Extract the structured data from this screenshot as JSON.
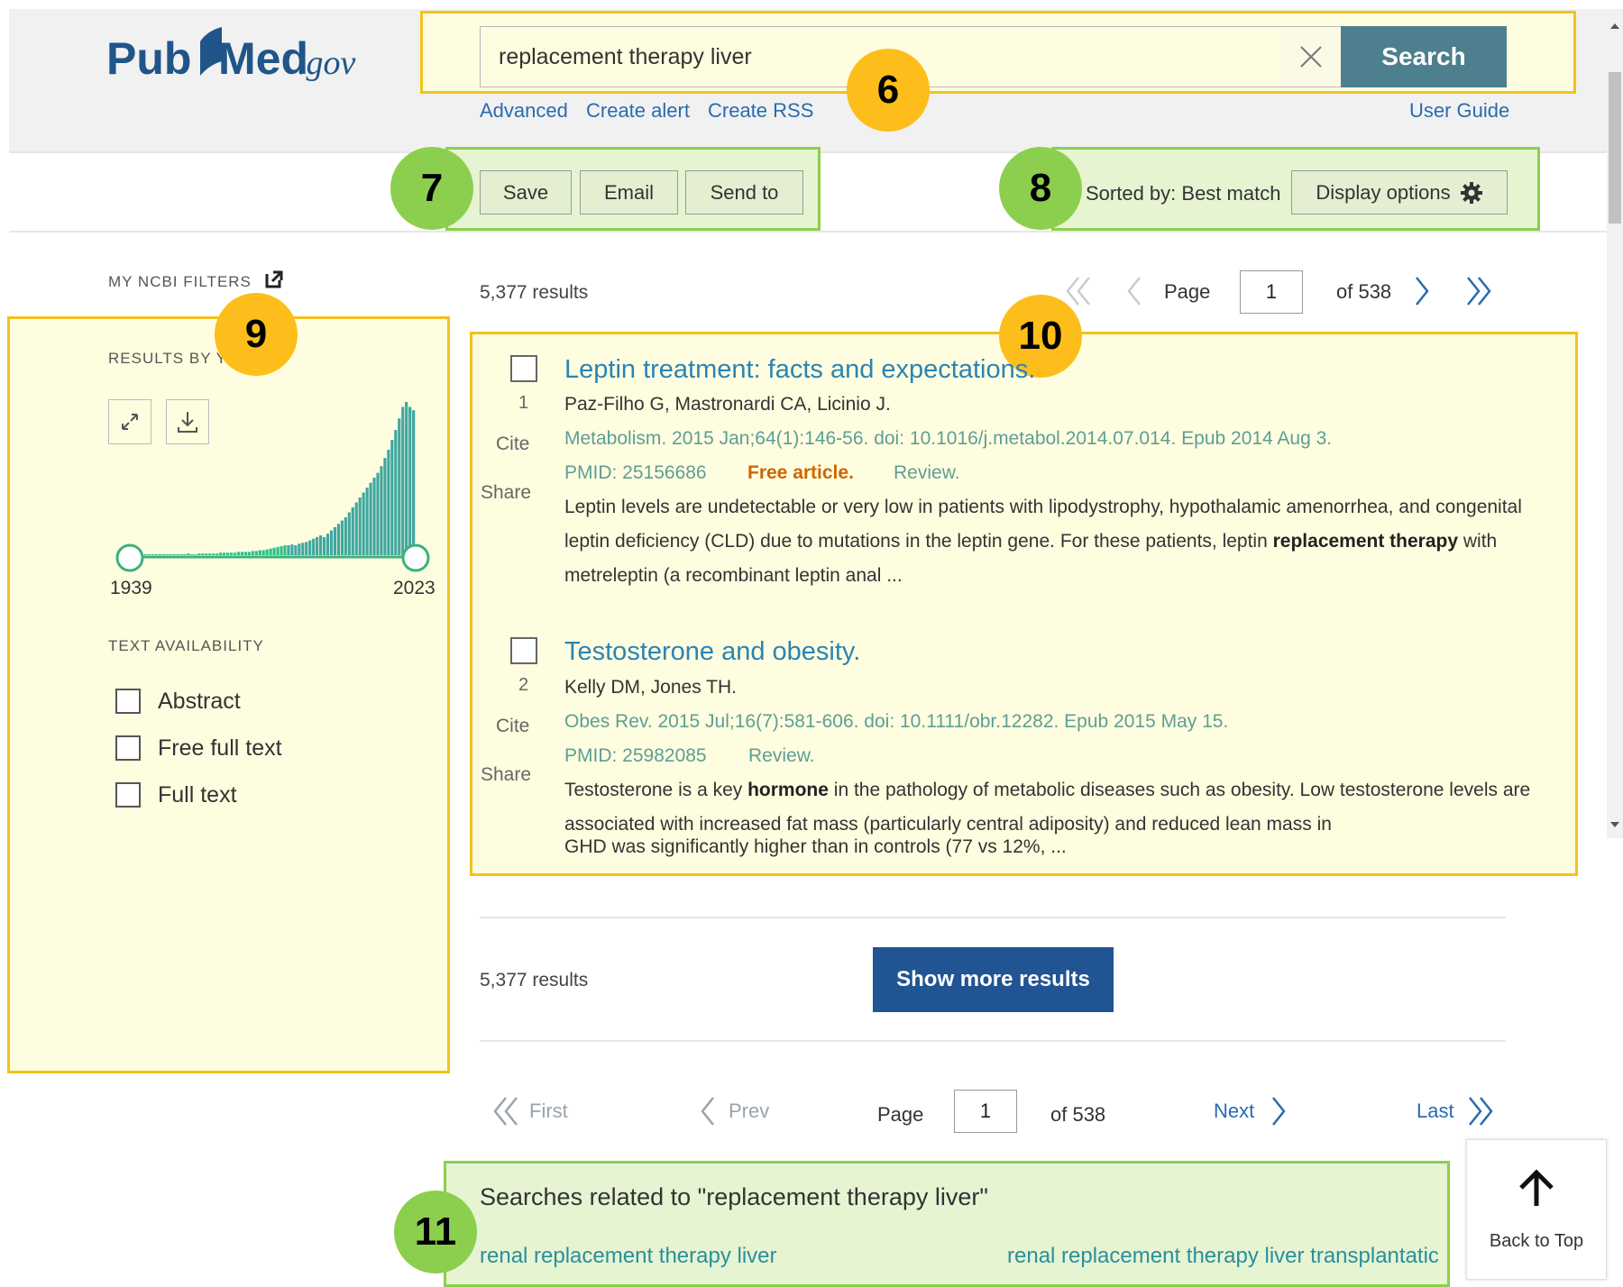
{
  "header": {
    "logo_pub": "Pub",
    "logo_med": "Med",
    "logo_gov": ".gov",
    "search_value": "replacement therapy liver",
    "search_button": "Search",
    "links": [
      "Advanced",
      "Create alert",
      "Create RSS"
    ],
    "user_guide": "User Guide"
  },
  "badges": {
    "b6": "6",
    "b7": "7",
    "b8": "8",
    "b9": "9",
    "b10": "10",
    "b11": "11"
  },
  "toolbar": {
    "save": "Save",
    "email": "Email",
    "send_to": "Send to",
    "sorted_by": "Sorted by: Best match",
    "display_options": "Display options"
  },
  "sidebar": {
    "my_ncbi_filters": "MY NCBI FILTERS",
    "results_by_year": "RESULTS BY YEAR",
    "year_start": "1939",
    "year_end": "2023",
    "text_availability": "TEXT AVAILABILITY",
    "filters": [
      "Abstract",
      "Free full text",
      "Full text"
    ],
    "histogram": [
      1,
      1,
      1,
      1,
      1,
      1,
      1,
      1,
      1,
      1,
      1,
      1,
      1,
      1,
      1,
      1,
      2,
      1,
      1,
      2,
      2,
      2,
      2,
      2,
      2,
      3,
      3,
      3,
      3,
      3,
      4,
      4,
      4,
      4,
      5,
      5,
      6,
      6,
      7,
      8,
      9,
      10,
      11,
      12,
      12,
      13,
      12,
      14,
      15,
      16,
      18,
      20,
      22,
      24,
      22,
      26,
      30,
      34,
      38,
      42,
      46,
      52,
      58,
      64,
      70,
      76,
      82,
      88,
      94,
      100,
      108,
      118,
      128,
      140,
      152,
      166,
      180,
      186,
      180,
      176
    ],
    "histogram_max": 186
  },
  "results": {
    "count_label": "5,377 results",
    "page_label": "Page",
    "page_value": "1",
    "of_label": "of 538",
    "items": [
      {
        "num": "1",
        "title": "Leptin treatment: facts and expectations.",
        "authors": "Paz-Filho G, Mastronardi CA, Licinio J.",
        "journal": "Metabolism. 2015 Jan;64(1):146-56. doi: 10.1016/j.metabol.2014.07.014. Epub 2014 Aug 3.",
        "pmid": "PMID: 25156686",
        "free": "Free article.",
        "review": "Review.",
        "snippet_a": "Leptin levels are undetectable or very low in patients with lipodystrophy, hypothalamic amenorrhea, and congenital leptin deficiency (CLD) due to mutations in the leptin gene. For these patients, leptin ",
        "snippet_b": "replacement therapy",
        "snippet_c": " with metreleptin (a recombinant leptin anal ..."
      },
      {
        "num": "2",
        "title": "Testosterone and obesity.",
        "authors": "Kelly DM, Jones TH.",
        "journal": "Obes Rev. 2015 Jul;16(7):581-606. doi: 10.1111/obr.12282. Epub 2015 May 15.",
        "pmid": "PMID: 25982085",
        "review": "Review.",
        "snippet_a": "Testosterone is a key ",
        "snippet_b": "hormone",
        "snippet_c": " in the pathology of metabolic diseases such as obesity. Low testosterone levels are associated with increased fat mass (particularly central adiposity) and reduced lean mass in",
        "snippet_d": "GHD was significantly higher than in controls (77 vs 12%, ..."
      }
    ],
    "cite": "Cite",
    "share": "Share"
  },
  "bottom": {
    "count_label": "5,377 results",
    "show_more": "Show more results",
    "first": "First",
    "prev": "Prev",
    "page_label": "Page",
    "page_value": "1",
    "of_label": "of 538",
    "next": "Next",
    "last": "Last"
  },
  "related": {
    "heading": "Searches related to \"replacement therapy liver\"",
    "links": [
      "renal replacement therapy liver",
      "renal replacement therapy liver transplantatic"
    ]
  },
  "back_to_top": "Back to Top",
  "colors": {
    "accent": "#2a84b4",
    "search_button": "#4d7f8e",
    "show_more": "#205493",
    "highlight_yellow": "#f3c21b",
    "highlight_green": "#8ccf4f"
  }
}
